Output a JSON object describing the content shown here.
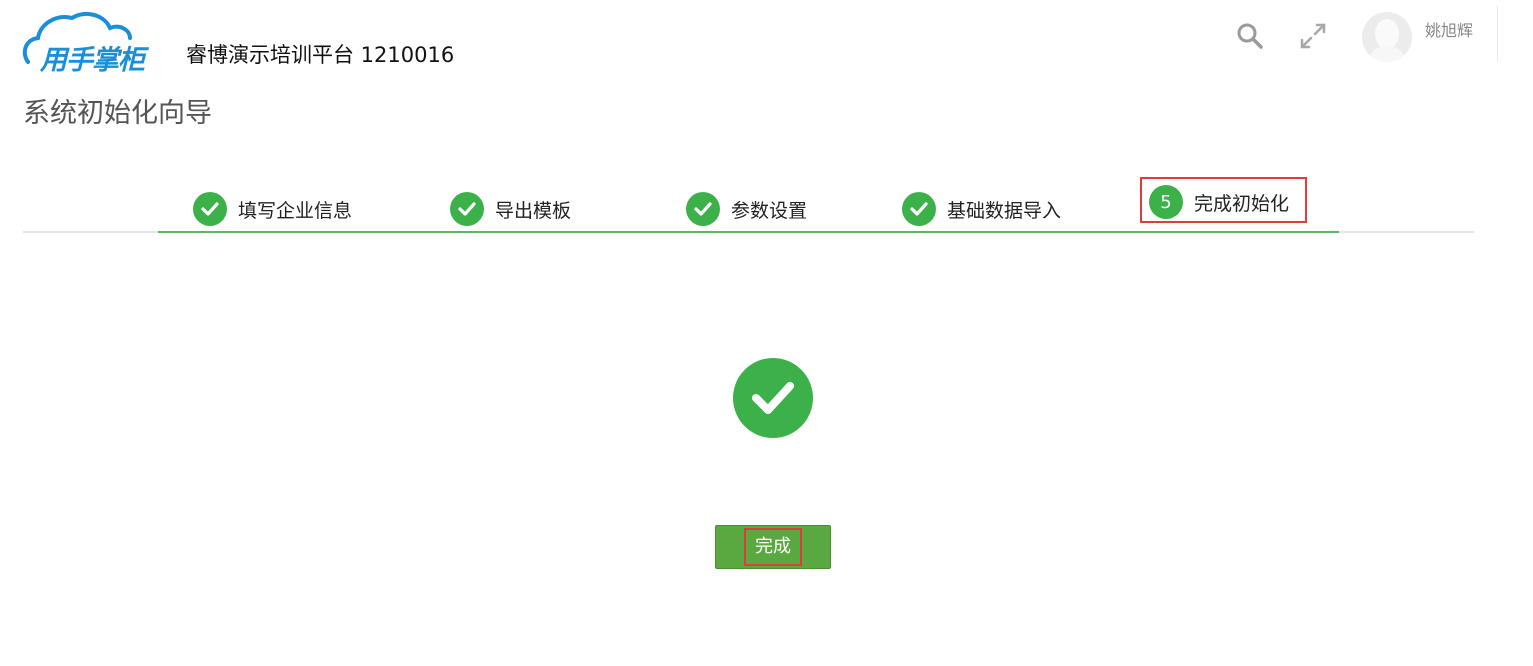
{
  "header": {
    "logo_text": "用手掌柜",
    "platform_name": "睿博演示培训平台  1210016",
    "user_name": "姚旭辉",
    "icons": [
      "search-icon",
      "fullscreen-icon",
      "avatar-icon"
    ]
  },
  "page_title": "系统初始化向导",
  "steps": [
    {
      "label": "填写企业信息",
      "status": "done"
    },
    {
      "label": "导出模板",
      "status": "done"
    },
    {
      "label": "参数设置",
      "status": "done"
    },
    {
      "label": "基础数据导入",
      "status": "done"
    },
    {
      "label": "完成初始化",
      "number": "5",
      "status": "current"
    }
  ],
  "main": {
    "status_icon": "check-circle-icon",
    "finish_button_label": "完成"
  },
  "colors": {
    "brand_blue": "#1a8fd9",
    "success_green": "#3cb14a",
    "button_green": "#5aa840",
    "highlight_red": "#e03c3c"
  }
}
